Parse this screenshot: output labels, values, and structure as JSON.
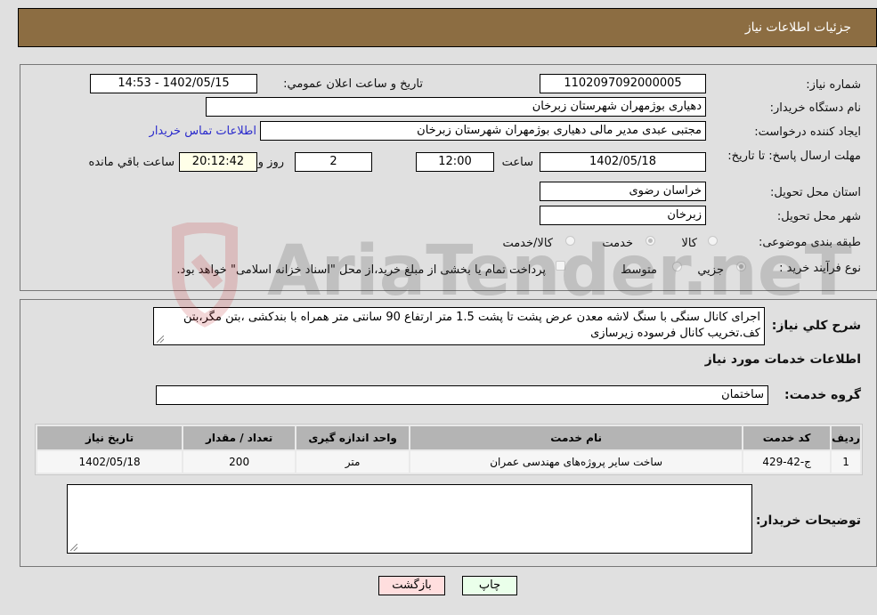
{
  "header": {
    "title": "جزئیات اطلاعات نیاز"
  },
  "form": {
    "need_number_label": "شماره نیاز:",
    "need_number": "1102097092000005",
    "announce_label": "تاریخ و ساعت اعلان عمومي:",
    "announce_value": "1402/05/15 - 14:53",
    "buyer_org_label": "نام دستگاه خریدار:",
    "buyer_org": "دهیاری بوژمهران شهرستان زبرخان",
    "creator_label": "ایجاد کننده درخواست:",
    "creator": "مجتبی عبدی مدیر مالی  دهیاری بوژمهران شهرستان زبرخان",
    "contact_link": "اطلاعات تماس خریدار",
    "deadline_label": "مهلت ارسال پاسخ: تا تاریخ:",
    "deadline_date": "1402/05/18",
    "time_label": "ساعت",
    "deadline_time": "12:00",
    "days": "2",
    "days_label": "روز و",
    "remaining_time": "20:12:42",
    "remaining_label": "ساعت باقي مانده",
    "province_label": "استان محل تحویل:",
    "province": "خراسان رضوی",
    "city_label": "شهر محل تحویل:",
    "city": "زبرخان",
    "category_label": "طبقه بندی موضوعی:",
    "category_options": [
      {
        "label": "کالا",
        "checked": false
      },
      {
        "label": "خدمت",
        "checked": true
      },
      {
        "label": "کالا/خدمت",
        "checked": false
      }
    ],
    "process_label": "نوع فرآیند خرید :",
    "process_options": [
      {
        "label": "جزيي",
        "checked": true
      },
      {
        "label": "متوسط",
        "checked": false
      }
    ],
    "treasury_note": "پرداخت تمام یا بخشی از مبلغ خرید،از محل \"اسناد خزانه اسلامی\" خواهد بود.",
    "treasury_checked": false
  },
  "description": {
    "label": "شرح کلي نياز:",
    "text": "اجرای کانال سنگی با سنگ لاشه معدن عرض پشت تا پشت 1.5 متر ارتفاع 90 سانتی متر همراه با بندکشی ،بتن مگر،بتن کف.تخریب کانال فرسوده زیرسازی"
  },
  "services": {
    "section_title": "اطلاعات خدمات مورد نیاز",
    "group_label": "گروه خدمت:",
    "group_value": "ساختمان",
    "columns": [
      "ردیف",
      "کد خدمت",
      "نام خدمت",
      "واحد اندازه گیری",
      "تعداد / مقدار",
      "تاریخ نیاز"
    ],
    "rows": [
      [
        "1",
        "ج-42-429",
        "ساخت سایر پروژه‌های مهندسی عمران",
        "متر",
        "200",
        "1402/05/18"
      ]
    ]
  },
  "buyer_notes": {
    "label": "توضیحات خریدار:",
    "value": ""
  },
  "buttons": {
    "print": "چاپ",
    "back": "بازگشت"
  },
  "watermark": {
    "text": "AriaTender.neT"
  },
  "colors": {
    "header_bg": "#8c6d42",
    "print_bg": "#eaffea",
    "back_bg": "#ffdede",
    "link": "#2a2acc"
  }
}
